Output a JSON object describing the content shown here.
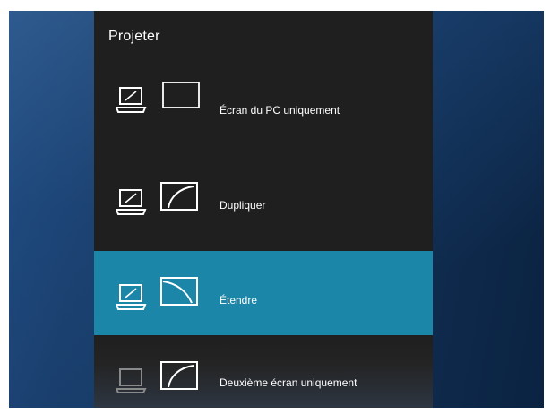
{
  "panel": {
    "title": "Projeter",
    "options": [
      {
        "label": "Écran du PC uniquement",
        "icon": "pc-screen-only-icon",
        "selected": false
      },
      {
        "label": "Dupliquer",
        "icon": "duplicate-icon",
        "selected": false
      },
      {
        "label": "Étendre",
        "icon": "extend-icon",
        "selected": true
      },
      {
        "label": "Deuxième écran uniquement",
        "icon": "second-screen-only-icon",
        "selected": false
      }
    ]
  },
  "colors": {
    "panel_bg": "#1f1f1f",
    "selected_bg": "#1c86a8",
    "desktop_bg": "#143860",
    "text": "#ffffff"
  }
}
